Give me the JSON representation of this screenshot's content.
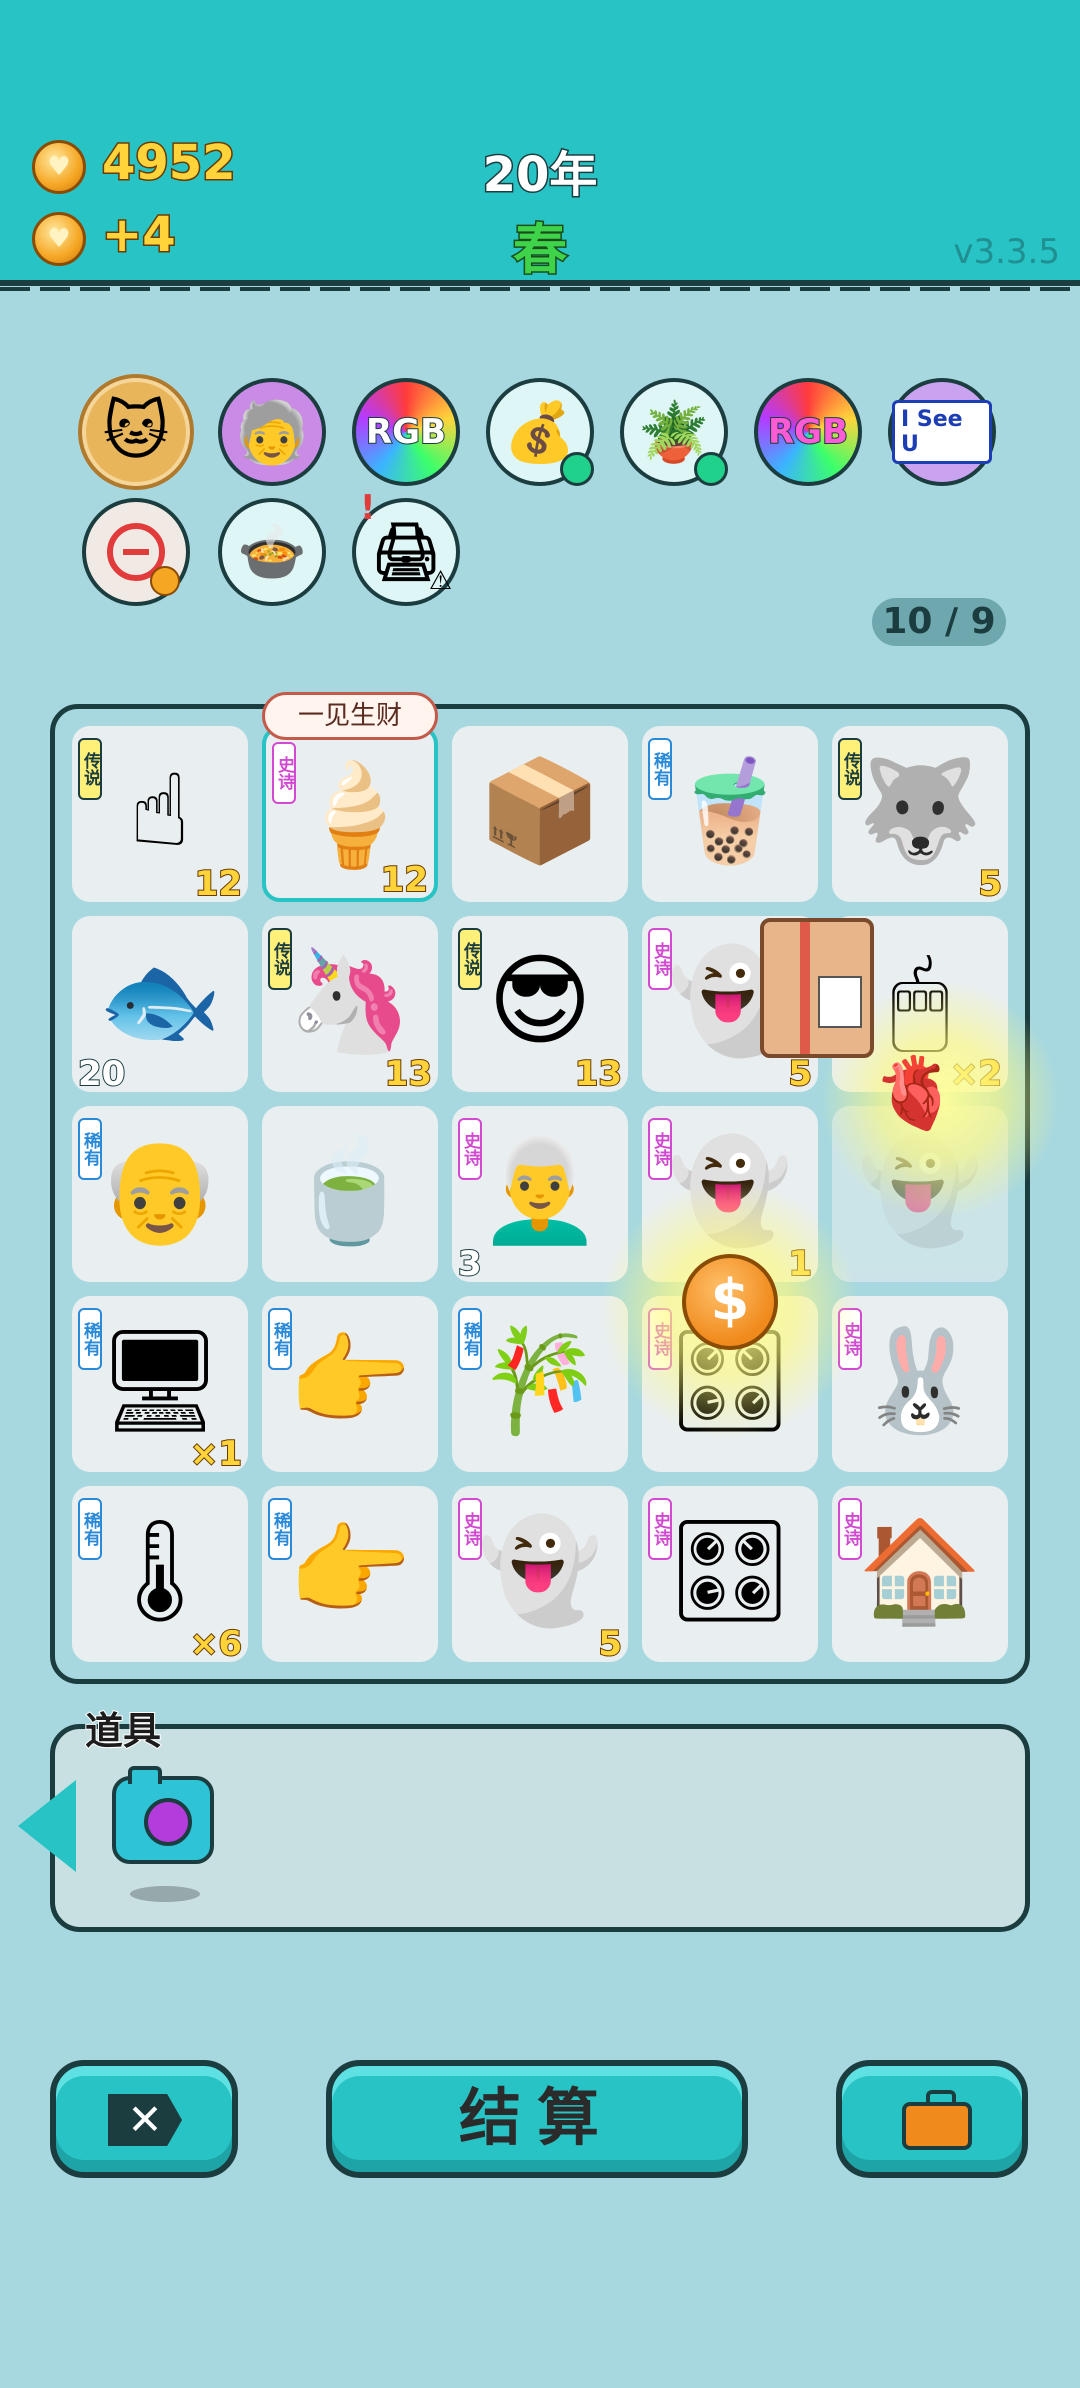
{
  "header": {
    "coins": "4952",
    "income": "+4",
    "year": "20年",
    "season": "春",
    "version": "v3.3.5"
  },
  "relics": [
    {
      "name": "cat-relic-icon"
    },
    {
      "name": "lottery-man-relic-icon"
    },
    {
      "name": "rgb-relic-icon",
      "text": "RGB"
    },
    {
      "name": "money-bag-relic-icon"
    },
    {
      "name": "flower-pot-relic-icon"
    },
    {
      "name": "rgb-relic-icon",
      "text": "RGB"
    },
    {
      "name": "i-see-u-relic-icon",
      "text": "I See U"
    },
    {
      "name": "minus-relic-icon"
    },
    {
      "name": "pressure-cooker-relic-icon"
    },
    {
      "name": "printer-relic-icon"
    }
  ],
  "slot_count": "10 / 9",
  "bubble": "一见生财",
  "tags": {
    "legend": "传说",
    "epic": "史诗",
    "rare": "稀有"
  },
  "board": [
    {
      "icon": "☝",
      "tag": "传说",
      "num": "12",
      "name": "pointing-hand-icon"
    },
    {
      "icon": "🍦",
      "tag": "史诗",
      "num": "12",
      "name": "ice-cream-icon"
    },
    {
      "icon": "📦",
      "tag": "",
      "num": "",
      "name": "cardboard-box-icon"
    },
    {
      "icon": "🧋",
      "tag": "稀有",
      "num": "",
      "name": "bubble-tea-icon"
    },
    {
      "icon": "🐺",
      "tag": "传说",
      "num": "5",
      "name": "husky-king-icon"
    },
    {
      "icon": "🐟",
      "tag": "",
      "num": "20",
      "name": "fish-icon",
      "numLeft": true
    },
    {
      "icon": "🦄",
      "tag": "传说",
      "num": "13",
      "name": "unicorn-icon"
    },
    {
      "icon": "😎",
      "tag": "传说",
      "num": "13",
      "name": "sunglasses-man-icon"
    },
    {
      "icon": "👻",
      "tag": "史诗",
      "num": "5",
      "name": "ghost-icon"
    },
    {
      "icon": "🖱",
      "tag": "",
      "num": "×2",
      "name": "mouse-icon"
    },
    {
      "icon": "👴",
      "tag": "稀有",
      "num": "",
      "name": "bald-man-icon"
    },
    {
      "icon": "🍵",
      "tag": "",
      "num": "",
      "name": "soup-bowl-icon"
    },
    {
      "icon": "👨‍🦳",
      "tag": "史诗",
      "num": "3",
      "name": "old-man-icon",
      "numLeft": true
    },
    {
      "icon": "👻",
      "tag": "史诗",
      "num": "1",
      "name": "ghost-icon"
    },
    {
      "icon": "👻",
      "tag": "",
      "num": "",
      "name": "ghost-faded-icon"
    },
    {
      "icon": "🖥",
      "tag": "稀有",
      "num": "×1",
      "name": "pc-tower-icon"
    },
    {
      "icon": "👉",
      "tag": "稀有",
      "num": "",
      "name": "pointing-finger-icon"
    },
    {
      "icon": "🎋",
      "tag": "稀有",
      "num": "",
      "name": "bamboo-icon"
    },
    {
      "icon": "🎛",
      "tag": "史诗",
      "num": "",
      "name": "gpu-icon"
    },
    {
      "icon": "🐰",
      "tag": "史诗",
      "num": "",
      "name": "rabbit-house-icon"
    },
    {
      "icon": "🌡",
      "tag": "稀有",
      "num": "×6",
      "name": "gauge-icon"
    },
    {
      "icon": "👉",
      "tag": "稀有",
      "num": "",
      "name": "pointing-finger-icon"
    },
    {
      "icon": "👻",
      "tag": "史诗",
      "num": "5",
      "name": "ghost-icon"
    },
    {
      "icon": "🎛",
      "tag": "史诗",
      "num": "",
      "name": "gpu-icon"
    },
    {
      "icon": "🏠",
      "tag": "史诗",
      "num": "",
      "name": "haunted-house-icon"
    }
  ],
  "items": {
    "label": "道具",
    "list": [
      {
        "name": "camera-icon"
      }
    ]
  },
  "buttons": {
    "settle": "结算"
  },
  "colors": {
    "teal": "#27c3c5",
    "dark": "#1c3d40",
    "gold": "#ffd43b",
    "bg": "#a8d8df"
  }
}
